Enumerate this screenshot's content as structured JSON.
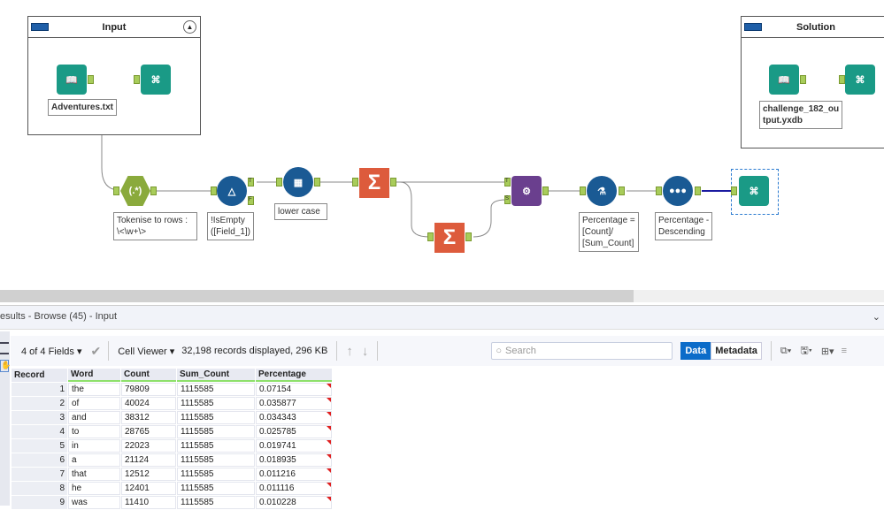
{
  "canvas": {
    "containers": [
      {
        "title": "Input"
      },
      {
        "title": "Solution"
      }
    ],
    "tools": [
      {
        "name": "input-data",
        "label": "Adventures.txt"
      },
      {
        "name": "browse-input",
        "label": ""
      },
      {
        "name": "regex",
        "label": "Tokenise to rows :\n\\<\\w+\\>",
        "glyph": "(.*)"
      },
      {
        "name": "filter",
        "label": "!IsEmpty\n([Field_1])",
        "anchors": [
          "T",
          "F"
        ]
      },
      {
        "name": "multi-field-formula",
        "label": "lower case"
      },
      {
        "name": "summarize-1",
        "label": "",
        "glyph": "Σ"
      },
      {
        "name": "summarize-2",
        "label": "",
        "glyph": "Σ"
      },
      {
        "name": "append-fields",
        "label": "",
        "anchors": [
          "T",
          "S"
        ]
      },
      {
        "name": "formula",
        "label": "Percentage =\n[Count]/\n[Sum_Count]"
      },
      {
        "name": "sort",
        "label": "Percentage -\nDescending"
      },
      {
        "name": "browse-output",
        "label": ""
      },
      {
        "name": "solution-input",
        "label": "challenge_182_ou\ntput.yxdb"
      },
      {
        "name": "solution-browse",
        "label": ""
      }
    ]
  },
  "results": {
    "title": "esults - Browse (45) - Input",
    "fields_label": "4 of 4 Fields",
    "viewer_label": "Cell Viewer",
    "records_info": "32,198 records displayed, 296 KB",
    "search_placeholder": "Search",
    "data_tab": "Data",
    "metadata_tab": "Metadata",
    "accent": "#0b6cc9",
    "columns": [
      "Record",
      "Word",
      "Count",
      "Sum_Count",
      "Percentage"
    ],
    "rows": [
      [
        "1",
        "the",
        "79809",
        "1115585",
        "0.07154"
      ],
      [
        "2",
        "of",
        "40024",
        "1115585",
        "0.035877"
      ],
      [
        "3",
        "and",
        "38312",
        "1115585",
        "0.034343"
      ],
      [
        "4",
        "to",
        "28765",
        "1115585",
        "0.025785"
      ],
      [
        "5",
        "in",
        "22023",
        "1115585",
        "0.019741"
      ],
      [
        "6",
        "a",
        "21124",
        "1115585",
        "0.018935"
      ],
      [
        "7",
        "that",
        "12512",
        "1115585",
        "0.011216"
      ],
      [
        "8",
        "he",
        "12401",
        "1115585",
        "0.011116"
      ],
      [
        "9",
        "was",
        "11410",
        "1115585",
        "0.010228"
      ]
    ]
  }
}
